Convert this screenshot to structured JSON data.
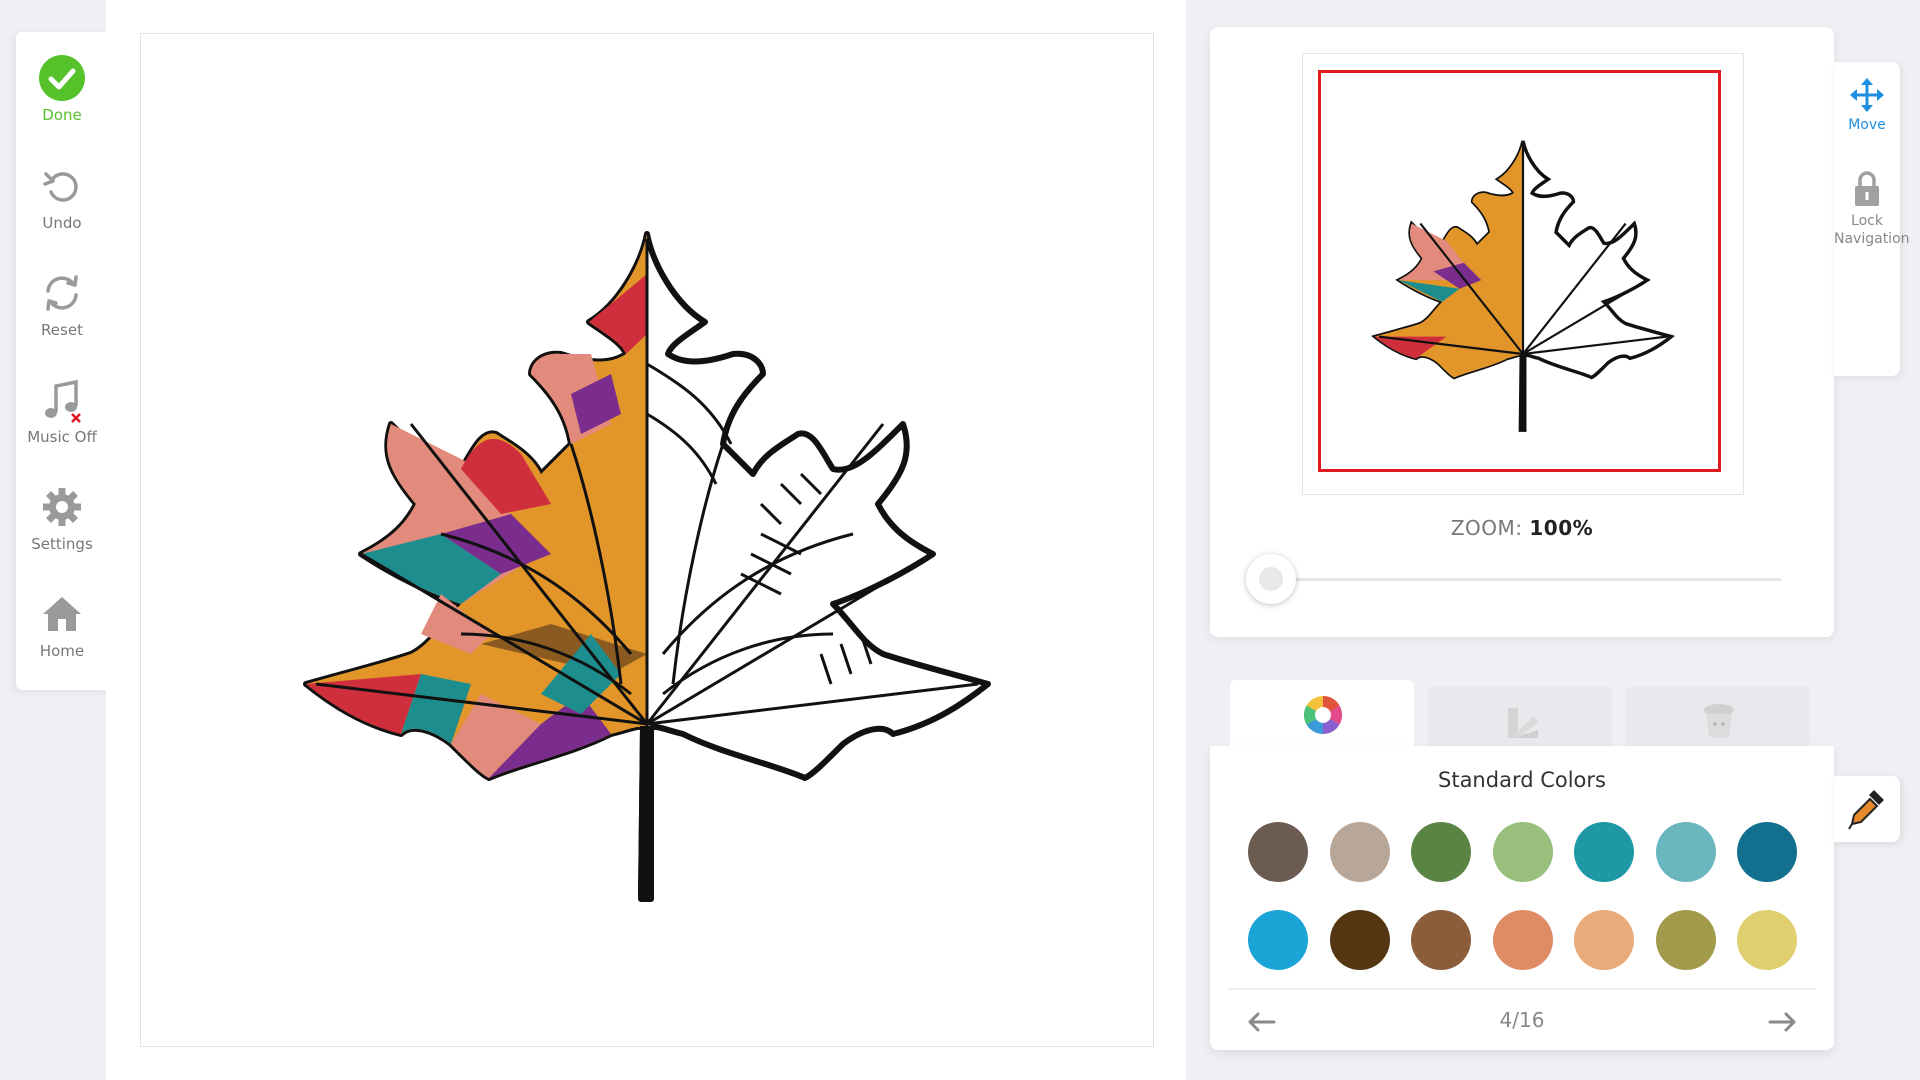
{
  "toolbar": {
    "done": "Done",
    "undo": "Undo",
    "reset": "Reset",
    "music": "Music Off",
    "settings": "Settings",
    "home": "Home"
  },
  "navigator": {
    "zoom_label": "ZOOM:",
    "zoom_value": "100%",
    "zoom_level": 0.0,
    "move": "Move",
    "lock_line1": "Lock",
    "lock_line2": "Navigation"
  },
  "palette": {
    "title": "Standard Colors",
    "page": "4/16",
    "swatches": [
      "#6b5b50",
      "#b8a698",
      "#5a8443",
      "#98bf7c",
      "#1e98a5",
      "#6ab6bf",
      "#136f8e",
      "#1ba4d6",
      "#553612",
      "#8b5d3b",
      "#de8c64",
      "#eaab7a",
      "#a39b4c",
      "#e0cf6e"
    ]
  },
  "colors": {
    "accent_green": "#56c22a",
    "viewport_red": "#e0191f",
    "accent_blue": "#1e8fe0"
  }
}
